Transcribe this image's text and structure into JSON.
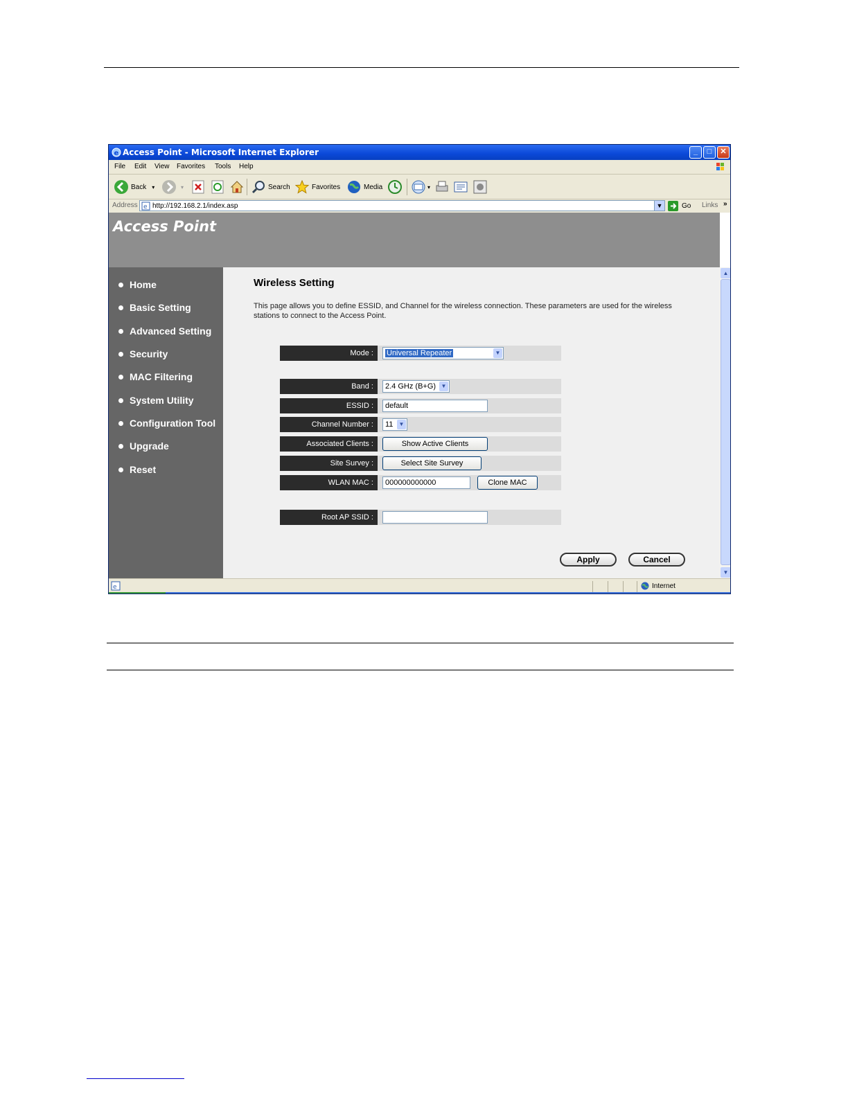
{
  "window": {
    "title": "Access Point - Microsoft Internet Explorer",
    "buttons": {
      "minimize": "_",
      "maximize": "□",
      "close": "✕"
    }
  },
  "menubar": {
    "items": [
      "File",
      "Edit",
      "View",
      "Favorites",
      "Tools",
      "Help"
    ]
  },
  "toolbar": {
    "back_label": "Back",
    "search_label": "Search",
    "favorites_label": "Favorites",
    "media_label": "Media"
  },
  "addressbar": {
    "label": "Address",
    "url": "http://192.168.2.1/index.asp",
    "go_label": "Go",
    "links_label": "Links"
  },
  "page": {
    "brand": "Access Point",
    "nav": [
      "Home",
      "Basic Setting",
      "Advanced Setting",
      "Security",
      "MAC Filtering",
      "System Utility",
      "Configuration Tool",
      "Upgrade",
      "Reset"
    ],
    "heading": "Wireless Setting",
    "description": "This page allows you to define ESSID, and Channel for the wireless connection. These parameters are used for the wireless stations to connect to the Access Point.",
    "form": {
      "mode_label": "Mode :",
      "mode_value": "Universal Repeater",
      "band_label": "Band :",
      "band_value": "2.4 GHz (B+G)",
      "essid_label": "ESSID :",
      "essid_value": "default",
      "channel_label": "Channel Number :",
      "channel_value": "11",
      "assoc_label": "Associated Clients :",
      "assoc_button": "Show Active Clients",
      "survey_label": "Site Survey :",
      "survey_button": "Select Site Survey",
      "wlanmac_label": "WLAN MAC :",
      "wlanmac_value": "000000000000",
      "clone_button": "Clone MAC",
      "rootap_label": "Root AP SSID :",
      "rootap_value": ""
    },
    "apply_label": "Apply",
    "cancel_label": "Cancel"
  },
  "statusbar": {
    "zone": "Internet"
  }
}
